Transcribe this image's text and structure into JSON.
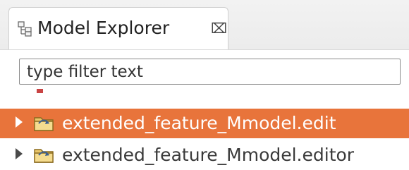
{
  "view": {
    "title": "Model Explorer",
    "close_glyph": "⌧",
    "icon": "model-explorer-icon"
  },
  "filter": {
    "placeholder": "type filter text",
    "value": ""
  },
  "tree": {
    "rows": [
      {
        "label": "extended_feature_Mmodel.edit",
        "selected": true,
        "icon": "project-folder-icon",
        "expanded": false
      },
      {
        "label": "extended_feature_Mmodel.editor",
        "selected": false,
        "icon": "project-folder-icon",
        "expanded": false
      }
    ]
  },
  "colors": {
    "selection": "#e8743b",
    "text": "#3a3a3a",
    "selected_text": "#ffffff"
  }
}
